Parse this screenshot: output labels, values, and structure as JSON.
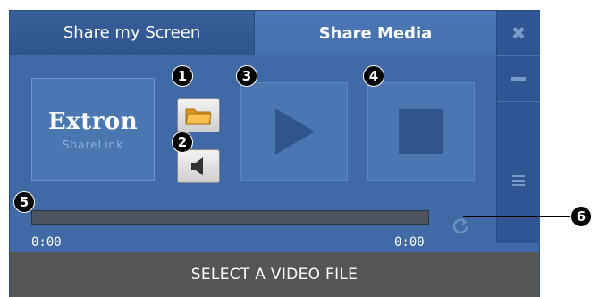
{
  "tabs": [
    {
      "label": "Share my Screen",
      "active": false
    },
    {
      "label": "Share Media",
      "active": true
    }
  ],
  "window_controls": {
    "close_icon": "close-icon",
    "minimize_icon": "minimize-icon",
    "menu_icon": "hamburger-menu-icon"
  },
  "logo": {
    "main": "Extron",
    "sub": "ShareLink"
  },
  "media_controls": {
    "open_folder_icon": "folder-icon",
    "volume_icon": "speaker-icon",
    "play_icon": "play-icon",
    "stop_icon": "stop-icon",
    "loop_icon": "loop-icon"
  },
  "badges": [
    "1",
    "2",
    "3",
    "4",
    "5",
    "6"
  ],
  "playback": {
    "position": "0:00",
    "duration": "0:00",
    "progress_fraction": 0
  },
  "status": {
    "text": "SELECT A VIDEO FILE"
  },
  "colors": {
    "panel": "#3f6aa6",
    "tab_active": "#4b78b6",
    "tab_inactive": "#2f5590",
    "status_bar": "#555555",
    "folder": "#f3b53c"
  }
}
